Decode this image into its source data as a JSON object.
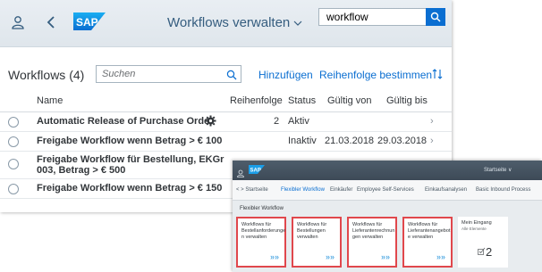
{
  "shell": {
    "app_title": "Workflows verwalten",
    "search_value": "workflow"
  },
  "list": {
    "title": "Workflows (4)",
    "search_placeholder": "Suchen",
    "add_label": "Hinzufügen",
    "order_label": "Reihenfolge bestimmen"
  },
  "columns": {
    "name": "Name",
    "order": "Reihenfolge",
    "status": "Status",
    "valid_from": "Gültig von",
    "valid_to": "Gültig bis"
  },
  "rows": [
    {
      "name": "Automatic Release of Purchase Order",
      "order": "2",
      "status": "Aktiv",
      "valid_from": "",
      "valid_to": ""
    },
    {
      "name": "Freigabe Workflow wenn Betrag > € 100",
      "order": "",
      "status": "Inaktiv",
      "valid_from": "21.03.2018",
      "valid_to": "29.03.2018"
    },
    {
      "name_line1": "Freigabe Workflow für Bestellung, EKGr",
      "name_line2": "003, Betrag > € 500"
    },
    {
      "name": "Freigabe Workflow wenn Betrag > € 150"
    }
  ],
  "inset": {
    "start_label": "Startseite ∨",
    "nav": [
      "< > Startseite",
      "Flexibler Workflow",
      "Einkäufer",
      "Employee Self-Services",
      "Einkaufsanalysen",
      "Basic Inbound Process"
    ],
    "group_title": "Flexibler Workflow",
    "tiles": [
      {
        "title": "Workflows für Bestellanforderunge n verwalten"
      },
      {
        "title": "Workflows für Bestellungen verwalten"
      },
      {
        "title": "Workflows für Lieferantenrechnun gen verwalten"
      },
      {
        "title": "Workflows für Lieferantenangebot e verwalten"
      }
    ],
    "inbox": {
      "title": "Mein Eingang",
      "subtitle": "Alle Elemente",
      "count": "2"
    }
  },
  "colors": {
    "accent": "#0a6ed1",
    "shell": "#355d7f",
    "highlight": "#e0474c"
  },
  "icons": [
    "user-icon",
    "back-icon",
    "sap-logo",
    "search-icon",
    "sort-icon",
    "gear-icon",
    "chevron-right-icon",
    "tile-arrow-icon",
    "inbox-check-icon"
  ]
}
